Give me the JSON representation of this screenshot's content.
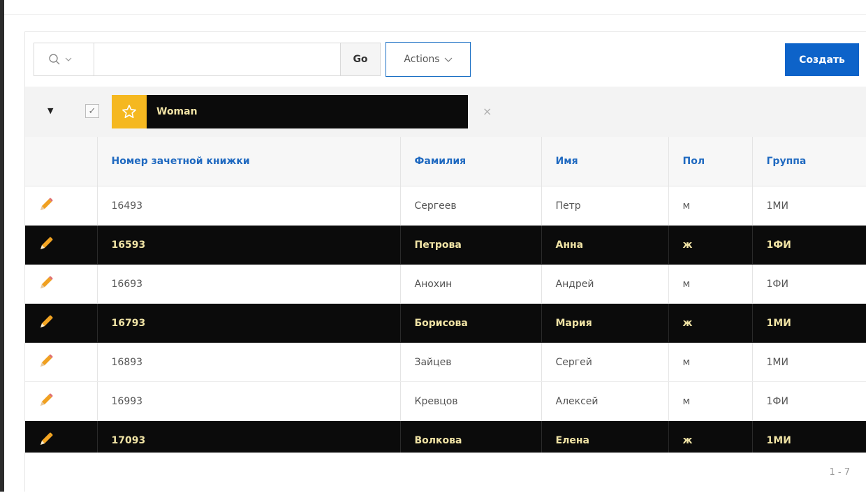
{
  "toolbar": {
    "search_icon": "search-icon",
    "search_value": "",
    "go_label": "Go",
    "actions_label": "Actions",
    "create_label": "Создать"
  },
  "filter": {
    "label": "Woman",
    "checked": true,
    "remove_glyph": "×"
  },
  "table": {
    "columns": [
      "Номер зачетной книжки",
      "Фамилия",
      "Имя",
      "Пол",
      "Группа"
    ],
    "rows": [
      {
        "id": "16493",
        "surname": "Сергеев",
        "name": "Петр",
        "sex": "м",
        "group": "1МИ",
        "highlight": false
      },
      {
        "id": "16593",
        "surname": "Петрова",
        "name": "Анна",
        "sex": "ж",
        "group": "1ФИ",
        "highlight": true
      },
      {
        "id": "16693",
        "surname": "Анохин",
        "name": "Андрей",
        "sex": "м",
        "group": "1ФИ",
        "highlight": false
      },
      {
        "id": "16793",
        "surname": "Борисова",
        "name": "Мария",
        "sex": "ж",
        "group": "1МИ",
        "highlight": true
      },
      {
        "id": "16893",
        "surname": "Зайцев",
        "name": "Сергей",
        "sex": "м",
        "group": "1МИ",
        "highlight": false
      },
      {
        "id": "16993",
        "surname": "Кревцов",
        "name": "Алексей",
        "sex": "м",
        "group": "1ФИ",
        "highlight": false
      },
      {
        "id": "17093",
        "surname": "Волкова",
        "name": "Елена",
        "sex": "ж",
        "group": "1МИ",
        "highlight": true
      }
    ]
  },
  "pagination": "1 - 7",
  "colors": {
    "accent": "#0d63c9",
    "highlight_bg": "#0b0b0b",
    "highlight_text": "#f0e3a5",
    "star_bg": "#f5b820",
    "pencil": "#f0a020"
  }
}
